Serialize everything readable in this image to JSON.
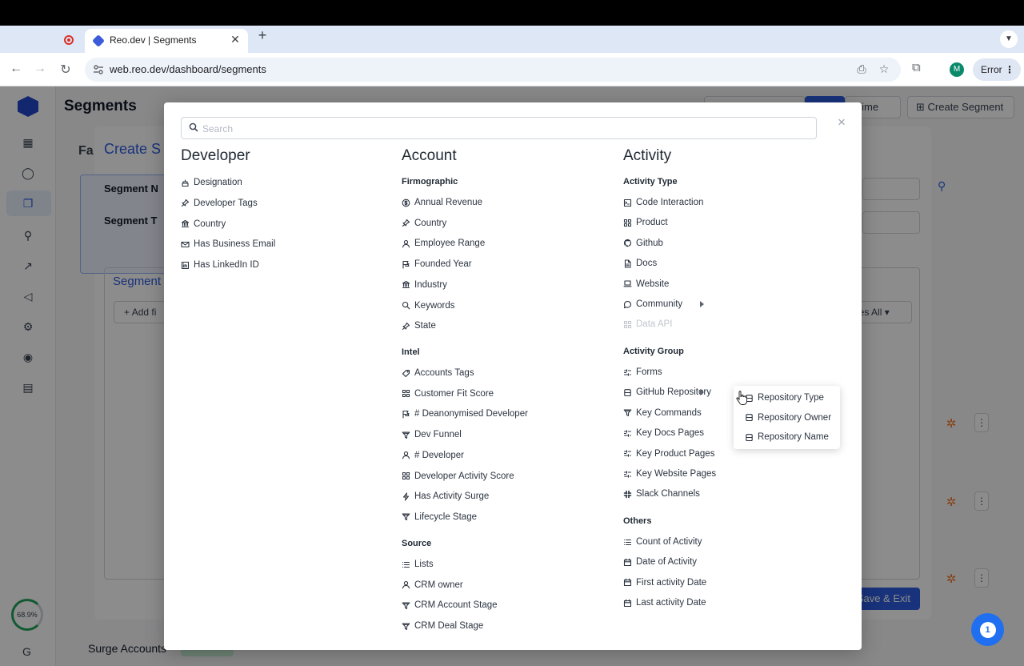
{
  "browser": {
    "tab_title": "Reo.dev | Segments",
    "tab_close": "✕",
    "new_tab": "+",
    "url": "web.reo.dev/dashboard/segments",
    "profile_initial": "M",
    "status_pill": "Error"
  },
  "app": {
    "page_title": "Segments",
    "topbar": {
      "time_filter": "l time",
      "create_segment": "Create Segment"
    },
    "progress_label": "68.9%",
    "footer_icon": "G",
    "bg_row_label": "Surge Accounts",
    "create_modal": {
      "title_fragment": "Create S",
      "left_fragment": "Fa",
      "segment_name_label": "Segment N",
      "segment_type_label": "Segment T",
      "inner_title": "Segment",
      "add_filter": "Add fi",
      "matches": "hes All",
      "save_exit": "Save & Exit"
    }
  },
  "picker": {
    "search_placeholder": "Search",
    "close_label": "×",
    "developer": {
      "title": "Developer",
      "items": [
        {
          "label": "Designation",
          "icon": "designation-icon"
        },
        {
          "label": "Developer Tags",
          "icon": "pin-icon"
        },
        {
          "label": "Country",
          "icon": "bank-icon"
        },
        {
          "label": "Has Business Email",
          "icon": "mail-icon"
        },
        {
          "label": "Has LinkedIn ID",
          "icon": "linkedin-icon"
        }
      ]
    },
    "account": {
      "title": "Account",
      "groups": [
        {
          "title": "Firmographic",
          "items": [
            {
              "label": "Annual Revenue",
              "icon": "dollar-icon"
            },
            {
              "label": "Country",
              "icon": "pin-icon"
            },
            {
              "label": "Employee Range",
              "icon": "user-icon"
            },
            {
              "label": "Founded Year",
              "icon": "flag-icon"
            },
            {
              "label": "Industry",
              "icon": "bank-icon"
            },
            {
              "label": "Keywords",
              "icon": "search-icon"
            },
            {
              "label": "State",
              "icon": "pin-icon"
            }
          ]
        },
        {
          "title": "Intel",
          "items": [
            {
              "label": "Accounts Tags",
              "icon": "tag-icon"
            },
            {
              "label": "Customer Fit Score",
              "icon": "grid-icon"
            },
            {
              "label": "# Deanonymised Developer",
              "icon": "flag-icon"
            },
            {
              "label": "Dev Funnel",
              "icon": "funnel-icon"
            },
            {
              "label": "# Developer",
              "icon": "user-icon"
            },
            {
              "label": "Developer Activity Score",
              "icon": "grid-icon"
            },
            {
              "label": "Has Activity Surge",
              "icon": "bolt-icon"
            },
            {
              "label": "Lifecycle Stage",
              "icon": "funnel-icon"
            }
          ]
        },
        {
          "title": "Source",
          "items": [
            {
              "label": "Lists",
              "icon": "list-icon"
            },
            {
              "label": "CRM owner",
              "icon": "user-icon"
            },
            {
              "label": "CRM Account Stage",
              "icon": "funnel-icon"
            },
            {
              "label": "CRM Deal Stage",
              "icon": "funnel-icon"
            }
          ]
        }
      ]
    },
    "activity": {
      "title": "Activity",
      "groups": [
        {
          "title": "Activity Type",
          "items": [
            {
              "label": "Code Interaction",
              "icon": "terminal-icon"
            },
            {
              "label": "Product",
              "icon": "grid-icon"
            },
            {
              "label": "Github",
              "icon": "github-icon"
            },
            {
              "label": "Docs",
              "icon": "doc-icon"
            },
            {
              "label": "Website",
              "icon": "laptop-icon"
            },
            {
              "label": "Community",
              "icon": "chat-icon",
              "has_submenu": true
            },
            {
              "label": "Data API",
              "icon": "grid-icon",
              "disabled": true
            }
          ]
        },
        {
          "title": "Activity Group",
          "items": [
            {
              "label": "Forms",
              "icon": "sliders-icon"
            },
            {
              "label": "GitHub Repository",
              "icon": "repo-icon",
              "has_submenu": true
            },
            {
              "label": "Key Commands",
              "icon": "funnel-icon"
            },
            {
              "label": "Key Docs Pages",
              "icon": "sliders-icon"
            },
            {
              "label": "Key Product Pages",
              "icon": "sliders-icon"
            },
            {
              "label": "Key Website Pages",
              "icon": "sliders-icon"
            },
            {
              "label": "Slack Channels",
              "icon": "slack-icon"
            }
          ]
        },
        {
          "title": "Others",
          "items": [
            {
              "label": "Count of Activity",
              "icon": "list-icon"
            },
            {
              "label": "Date of Activity",
              "icon": "calendar-icon"
            },
            {
              "label": "First activity Date",
              "icon": "calendar-icon"
            },
            {
              "label": "Last activity Date",
              "icon": "calendar-icon"
            }
          ]
        }
      ]
    },
    "github_submenu": {
      "items": [
        {
          "label": "Repository Type",
          "icon": "repo-icon"
        },
        {
          "label": "Repository Owner",
          "icon": "repo-icon"
        },
        {
          "label": "Repository Name",
          "icon": "repo-icon"
        }
      ]
    }
  },
  "chat_bubble": {
    "count": "1",
    "color": "#1f6ff0"
  },
  "colors": {
    "accent": "#2c5ce0",
    "hubspot": "#f57722"
  }
}
